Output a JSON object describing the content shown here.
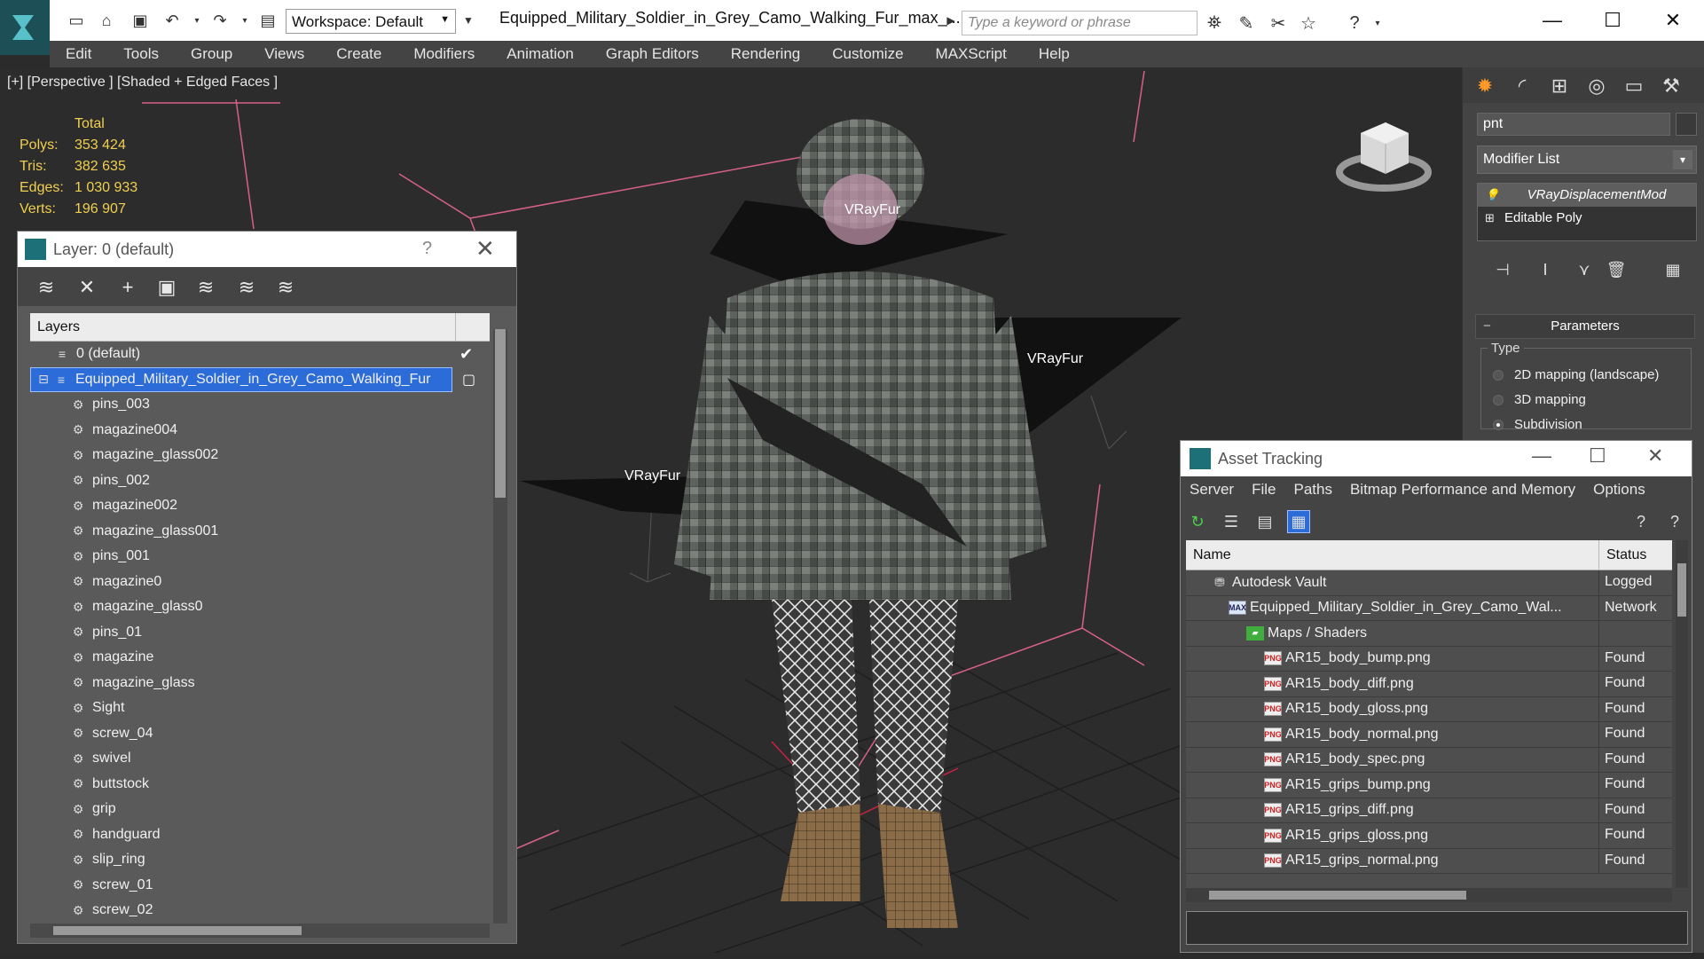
{
  "app": {
    "title": "Equipped_Military_Soldier_in_Grey_Camo_Walking_Fur_max_...",
    "workspace": "Workspace: Default",
    "search_placeholder": "Type a keyword or phrase"
  },
  "menu": [
    "Edit",
    "Tools",
    "Group",
    "Views",
    "Create",
    "Modifiers",
    "Animation",
    "Graph Editors",
    "Rendering",
    "Customize",
    "MAXScript",
    "Help"
  ],
  "viewport": {
    "label": "[+] [Perspective ] [Shaded + Edged Faces ]",
    "stats": {
      "header": "Total",
      "rows": [
        {
          "k": "Polys:",
          "v": "353 424"
        },
        {
          "k": "Tris:",
          "v": "382 635"
        },
        {
          "k": "Edges:",
          "v": "1 030 933"
        },
        {
          "k": "Verts:",
          "v": "196 907"
        }
      ]
    },
    "vray_labels": [
      "VRayFur",
      "VRayFur",
      "VRayFur"
    ]
  },
  "layer_window": {
    "title": "Layer: 0 (default)",
    "help": "?",
    "list_header": "Layers",
    "default_layer": "0 (default)",
    "selected_layer": "Equipped_Military_Soldier_in_Grey_Camo_Walking_Fur",
    "objects": [
      "pins_003",
      "magazine004",
      "magazine_glass002",
      "pins_002",
      "magazine002",
      "magazine_glass001",
      "pins_001",
      "magazine0",
      "magazine_glass0",
      "pins_01",
      "magazine",
      "magazine_glass",
      "Sight",
      "screw_04",
      "swivel",
      "buttstock",
      "grip",
      "handguard",
      "slip_ring",
      "screw_01",
      "screw_02"
    ]
  },
  "command_panel": {
    "object_name": "pnt",
    "modifier_list": "Modifier List",
    "stack": [
      "VRayDisplacementMod",
      "Editable Poly"
    ],
    "parameters_title": "Parameters",
    "type_label": "Type",
    "type_options": [
      {
        "label": "2D mapping (landscape)",
        "selected": false
      },
      {
        "label": "3D mapping",
        "selected": false
      },
      {
        "label": "Subdivision",
        "selected": true
      }
    ]
  },
  "asset_tracking": {
    "title": "Asset Tracking",
    "menu": [
      "Server",
      "File",
      "Paths",
      "Bitmap Performance and Memory",
      "Options"
    ],
    "columns": [
      "Name",
      "Status"
    ],
    "rows": [
      {
        "name": "Autodesk Vault",
        "status": "Logged",
        "icon": "vault",
        "indent": 0
      },
      {
        "name": "Equipped_Military_Soldier_in_Grey_Camo_Wal...",
        "status": "Network",
        "icon": "max",
        "indent": 1
      },
      {
        "name": "Maps / Shaders",
        "status": "",
        "icon": "maps",
        "indent": 2
      },
      {
        "name": "AR15_body_bump.png",
        "status": "Found",
        "icon": "png",
        "indent": 3
      },
      {
        "name": "AR15_body_diff.png",
        "status": "Found",
        "icon": "png",
        "indent": 3
      },
      {
        "name": "AR15_body_gloss.png",
        "status": "Found",
        "icon": "png",
        "indent": 3
      },
      {
        "name": "AR15_body_normal.png",
        "status": "Found",
        "icon": "png",
        "indent": 3
      },
      {
        "name": "AR15_body_spec.png",
        "status": "Found",
        "icon": "png",
        "indent": 3
      },
      {
        "name": "AR15_grips_bump.png",
        "status": "Found",
        "icon": "png",
        "indent": 3
      },
      {
        "name": "AR15_grips_diff.png",
        "status": "Found",
        "icon": "png",
        "indent": 3
      },
      {
        "name": "AR15_grips_gloss.png",
        "status": "Found",
        "icon": "png",
        "indent": 3
      },
      {
        "name": "AR15_grips_normal.png",
        "status": "Found",
        "icon": "png",
        "indent": 3
      }
    ],
    "png_badge": "PNG",
    "max_badge": "MAX"
  },
  "colors": {
    "selection": "#2c6cd8",
    "stats_text": "#f0d050",
    "active_tab": "#ff9a2a"
  }
}
